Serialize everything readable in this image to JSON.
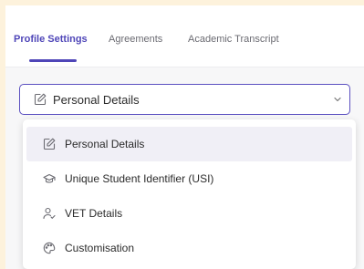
{
  "tabs": [
    {
      "label": "Profile Settings",
      "active": true
    },
    {
      "label": "Agreements",
      "active": false
    },
    {
      "label": "Academic Transcript",
      "active": false
    }
  ],
  "select": {
    "value": "Personal Details",
    "icon": "edit-icon",
    "open": true
  },
  "menu": {
    "items": [
      {
        "label": "Personal Details",
        "icon": "edit-icon",
        "selected": true
      },
      {
        "label": "Unique Student Identifier (USI)",
        "icon": "graduation-cap-icon",
        "selected": false
      },
      {
        "label": "VET Details",
        "icon": "user-check-icon",
        "selected": false
      },
      {
        "label": "Customisation",
        "icon": "palette-icon",
        "selected": false
      }
    ]
  },
  "colors": {
    "accent": "#4f46b8",
    "outer_background": "#fdf2dc",
    "selected_item_background": "#f0eff6"
  }
}
